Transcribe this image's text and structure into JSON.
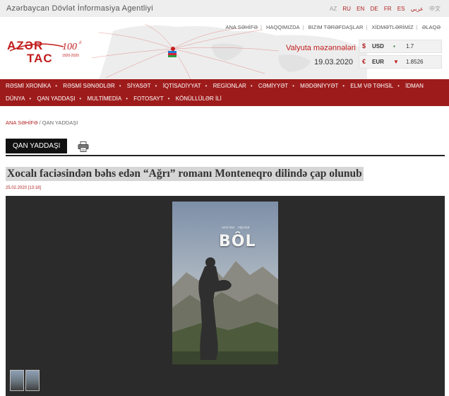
{
  "header": {
    "agency_name": "Azərbaycan Dövlət İnformasiya Agentliyi",
    "logo": {
      "line1": "AZƏR",
      "line2": "TAC",
      "badge": "100",
      "badge_sup": "il",
      "years": "1920-2020"
    },
    "languages": [
      {
        "code": "AZ",
        "active": false
      },
      {
        "code": "RU",
        "active": true
      },
      {
        "code": "EN",
        "active": true
      },
      {
        "code": "DE",
        "active": true
      },
      {
        "code": "FR",
        "active": true
      },
      {
        "code": "ES",
        "active": true
      },
      {
        "code": "عربي",
        "active": true
      },
      {
        "code": "中文",
        "active": false
      }
    ],
    "top_links": [
      "ANA SƏHİFƏ",
      "HAQQIMIZDA",
      "BIZIM TƏRƏFDAŞLAR",
      "XİDMƏTLƏRİMİZ",
      "ƏLAQƏ"
    ],
    "currency": {
      "label": "Valyuta məzənnələri",
      "date": "19.03.2020",
      "rates": [
        {
          "symbol": "$",
          "code": "USD",
          "trend": "flat",
          "trend_glyph": "▪",
          "value": "1.7"
        },
        {
          "symbol": "€",
          "code": "EUR",
          "trend": "down",
          "trend_glyph": "▼",
          "value": "1.8526"
        }
      ]
    }
  },
  "nav": {
    "row1": [
      "RƏSMİ XRONİKA",
      "RƏSMİ SƏNƏDLƏR",
      "SİYASƏT",
      "İQTİSADİYYAT",
      "REGİONLAR",
      "CƏMİYYƏT",
      "MƏDƏNİYYƏT",
      "ELM VƏ TƏHSİL",
      "İDMAN"
    ],
    "row2": [
      "DÜNYA",
      "QAN YADDAŞI",
      "MULTİMEDİA",
      "FOTOSAYT",
      "KÖNÜLLÜLƏR İLİ"
    ]
  },
  "breadcrumb": {
    "home": "ANA SƏHİFƏ",
    "sep": " / ",
    "current": "QAN YADDAŞI"
  },
  "section": {
    "title": "QAN YADDAŞI"
  },
  "article": {
    "headline": "Xocalı faciəsindən bəhs edən “Ağrı” romanı Monteneqro dilində çap olunub",
    "datetime": "25.02.2020 [13:18]"
  },
  "book_cover": {
    "authors": [
      "Amir Gut",
      "Arja Gut"
    ],
    "title": "BÔL"
  },
  "colors": {
    "brand_red": "#9e1b1b",
    "link_red": "#b12323",
    "trend_down": "#c21d1d",
    "trend_flat": "#2e7d32"
  }
}
